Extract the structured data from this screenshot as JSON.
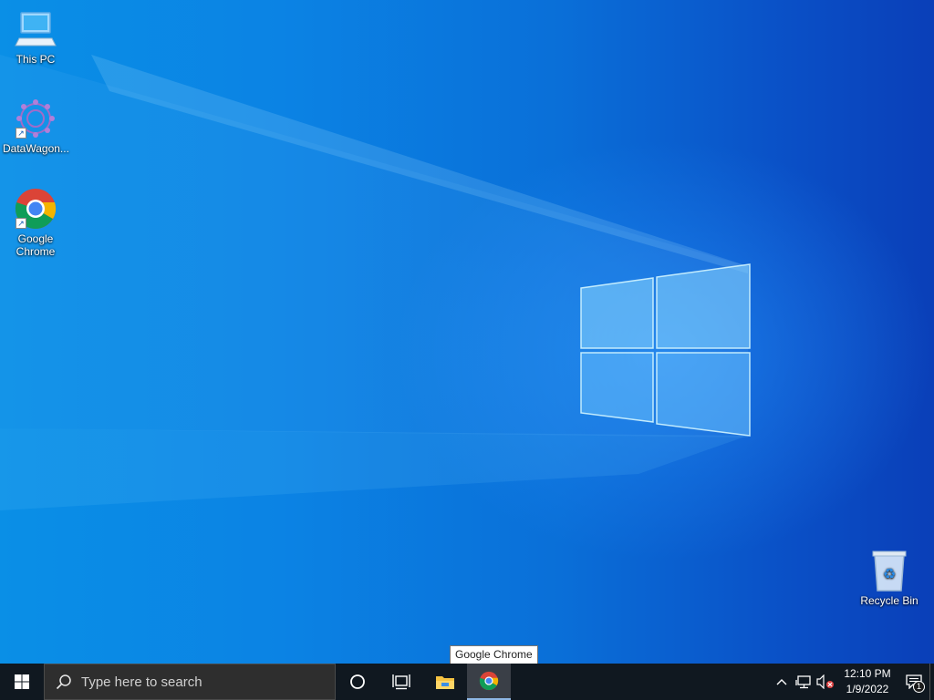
{
  "desktop": {
    "icons": [
      {
        "label": "This PC",
        "icon": "computer-icon"
      },
      {
        "label": "DataWagon...",
        "icon": "datawagon-icon"
      },
      {
        "label": "Google Chrome",
        "icon": "chrome-icon"
      },
      {
        "label": "Recycle Bin",
        "icon": "recycle-bin-icon"
      }
    ]
  },
  "tooltip": {
    "text": "Google Chrome"
  },
  "taskbar": {
    "search_placeholder": "Type here to search",
    "apps": [
      {
        "name": "Cortana",
        "icon": "cortana-icon"
      },
      {
        "name": "Task View",
        "icon": "task-view-icon"
      },
      {
        "name": "File Explorer",
        "icon": "folder-icon"
      },
      {
        "name": "Google Chrome",
        "icon": "chrome-icon"
      }
    ],
    "clock": {
      "time": "12:10 PM",
      "date": "1/9/2022"
    },
    "notification_count": "1"
  },
  "colors": {
    "wallpaper": "#0a6fd6",
    "taskbar": "#101820",
    "search_box": "#2e2e2e"
  }
}
